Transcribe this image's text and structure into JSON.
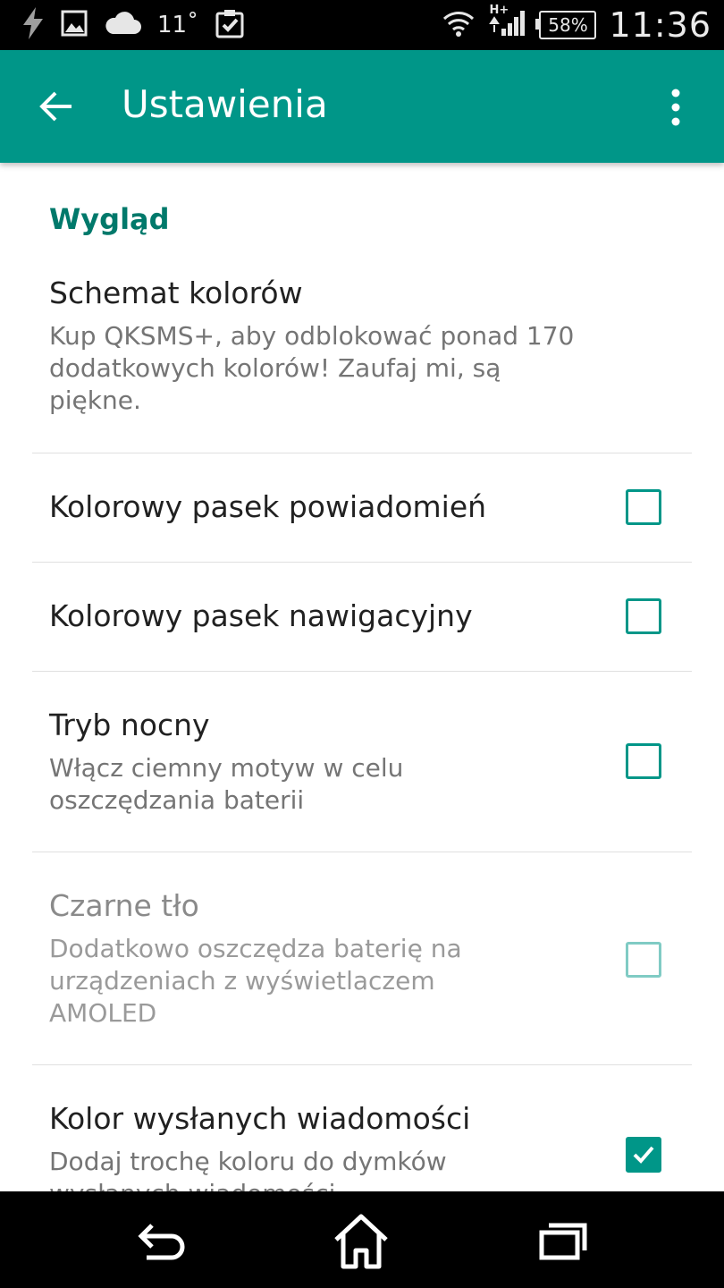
{
  "status_bar": {
    "temperature": "11˚",
    "battery": "58%",
    "time": "11:36",
    "network": "H+",
    "icons": [
      "flash-icon",
      "image-icon",
      "cloud-icon",
      "clipboard-check-icon",
      "wifi-icon",
      "signal-icon",
      "battery-icon"
    ]
  },
  "app_bar": {
    "title": "Ustawienia",
    "color": "#009688"
  },
  "section": {
    "title": "Wygląd"
  },
  "settings": [
    {
      "title": "Schemat kolorów",
      "subtitle": "Kup QKSMS+, aby odblokować ponad 170 dodatkowych kolorów! Zaufaj mi, są piękne."
    },
    {
      "title": "Kolorowy pasek powiadomień",
      "checked": false
    },
    {
      "title": "Kolorowy pasek nawigacyjny",
      "checked": false
    },
    {
      "title": "Tryb nocny",
      "subtitle": "Włącz ciemny motyw w celu oszczędzania baterii",
      "checked": false
    },
    {
      "title": "Czarne tło",
      "subtitle": "Dodatkowo oszczędza baterię na urządzeniach z wyświetlaczem AMOLED",
      "checked": false,
      "enabled": false
    },
    {
      "title": "Kolor wysłanych wiadomości",
      "subtitle": "Dodaj trochę koloru do dymków wysłanych wiadomości",
      "checked": true
    }
  ],
  "nav_bar": {
    "icons": [
      "back-icon",
      "home-icon",
      "recent-apps-icon"
    ]
  }
}
